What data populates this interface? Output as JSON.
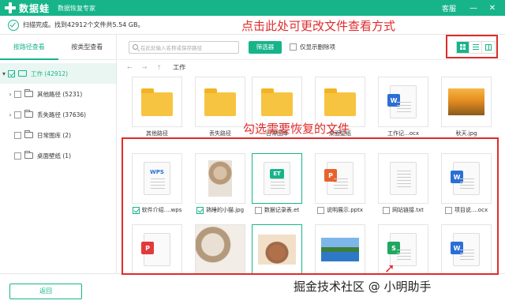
{
  "titlebar": {
    "app_name": "数据蛙",
    "subtitle": "数据恢复专家",
    "service_label": "客服",
    "minimize_glyph": "—",
    "close_glyph": "✕"
  },
  "status": {
    "text": "扫描完成。找到42912个文件共5.54 GB。"
  },
  "sidebar": {
    "tabs": [
      "按路径查看",
      "按类型查看"
    ],
    "root": {
      "label": "工作 (42912)",
      "checked": true
    },
    "items": [
      {
        "label": "其他路径 (5231)",
        "has_children": true
      },
      {
        "label": "丢失路径 (37636)",
        "has_children": true
      },
      {
        "label": "日常图库 (2)",
        "has_children": false
      },
      {
        "label": "桌面壁纸 (1)",
        "has_children": false
      }
    ]
  },
  "toolbar": {
    "search_placeholder": "在此处输入名称或保存路径",
    "filter_label": "筛选器",
    "only_deleted_label": "仅显示删除项"
  },
  "breadcrumb": {
    "back": "←",
    "forward": "→",
    "up": "↑",
    "current": "工作"
  },
  "files_row1": [
    {
      "name": "其他路径",
      "type": "folder"
    },
    {
      "name": "丢失路径",
      "type": "folder"
    },
    {
      "name": "日常图库",
      "type": "folder"
    },
    {
      "name": "桌面壁纸",
      "type": "folder"
    },
    {
      "name": "工作记...ocx",
      "type": "word",
      "badge": "W"
    },
    {
      "name": "秋天.jpg",
      "type": "photo-autumn"
    }
  ],
  "files_row2": [
    {
      "name": "软件介绍....wps",
      "type": "wps",
      "badge": "WPS",
      "checked": true
    },
    {
      "name": "熟睡的小猫.jpg",
      "type": "photo-cat",
      "checked": true
    },
    {
      "name": "数据记录表.et",
      "type": "et",
      "badge": "ET",
      "checked": false
    },
    {
      "name": "说明展示.pptx",
      "type": "ppt",
      "badge": "P",
      "checked": false
    },
    {
      "name": "网站链接.txt",
      "type": "txt",
      "checked": false
    },
    {
      "name": "项目说....ocx",
      "type": "word",
      "badge": "W",
      "checked": false
    }
  ],
  "files_row3": [
    {
      "type": "pdf",
      "badge": "P"
    },
    {
      "type": "photo-cats"
    },
    {
      "type": "photo-rabbit"
    },
    {
      "type": "photo-lake"
    },
    {
      "type": "sheet",
      "badge": "S"
    },
    {
      "type": "word",
      "badge": "W"
    }
  ],
  "bottom": {
    "back_label": "返回"
  },
  "annotations": {
    "view_hint": "点击此处可更改文件查看方式",
    "select_hint": "勾选需要恢复的文件",
    "watermark": "掘金技术社区 @ 小明助手"
  },
  "colors": {
    "accent": "#17b48a",
    "annotation_red": "#e02b2b",
    "word_blue": "#2b6fd6",
    "ppt_orange": "#e9612b",
    "pdf_red": "#e03a3a",
    "sheet_green": "#1fa760"
  }
}
